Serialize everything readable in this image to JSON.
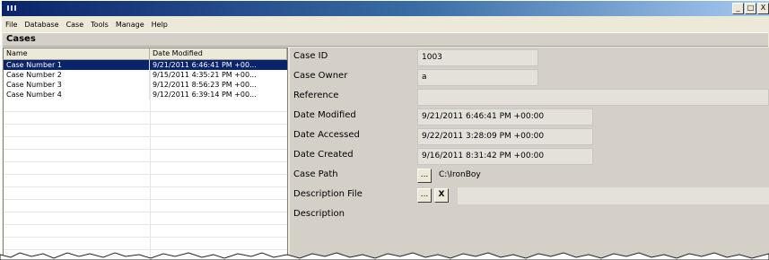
{
  "menubar": {
    "items": [
      "File",
      "Database",
      "Case",
      "Tools",
      "Manage",
      "Help"
    ]
  },
  "titlebar": {
    "minimize": "_",
    "maximize": "□",
    "close": "X"
  },
  "cases_panel": {
    "title": "Cases"
  },
  "case_list": {
    "columns": [
      "Name",
      "Date Modified"
    ],
    "rows": [
      {
        "name": "Case Number 1",
        "date": "9/21/2011 6:46:41 PM +00...",
        "selected": true
      },
      {
        "name": "Case Number 2",
        "date": "9/15/2011 4:35:21 PM +00...",
        "selected": false
      },
      {
        "name": "Case Number 3",
        "date": "9/12/2011 8:56:23 PM +00...",
        "selected": false
      },
      {
        "name": "Case Number 4",
        "date": "9/12/2011 6:39:14 PM +00...",
        "selected": false
      }
    ]
  },
  "properties": {
    "case_id": {
      "label": "Case ID",
      "value": "1003"
    },
    "case_owner": {
      "label": "Case Owner",
      "value": "a"
    },
    "reference": {
      "label": "Reference",
      "value": ""
    },
    "date_modified": {
      "label": "Date Modified",
      "value": "9/21/2011 6:46:41 PM +00:00"
    },
    "date_accessed": {
      "label": "Date Accessed",
      "value": "9/22/2011 3:28:09 PM +00:00"
    },
    "date_created": {
      "label": "Date Created",
      "value": "9/16/2011 8:31:42 PM +00:00"
    },
    "case_path": {
      "label": "Case Path",
      "value": "C:\\IronBoy",
      "browse": "..."
    },
    "description_file": {
      "label": "Description File",
      "browse": "...",
      "clear": "X"
    },
    "description": {
      "label": "Description"
    }
  },
  "colors": {
    "selection": "#0a246a",
    "panel": "#d4d0c8",
    "window": "#ece9d8"
  }
}
